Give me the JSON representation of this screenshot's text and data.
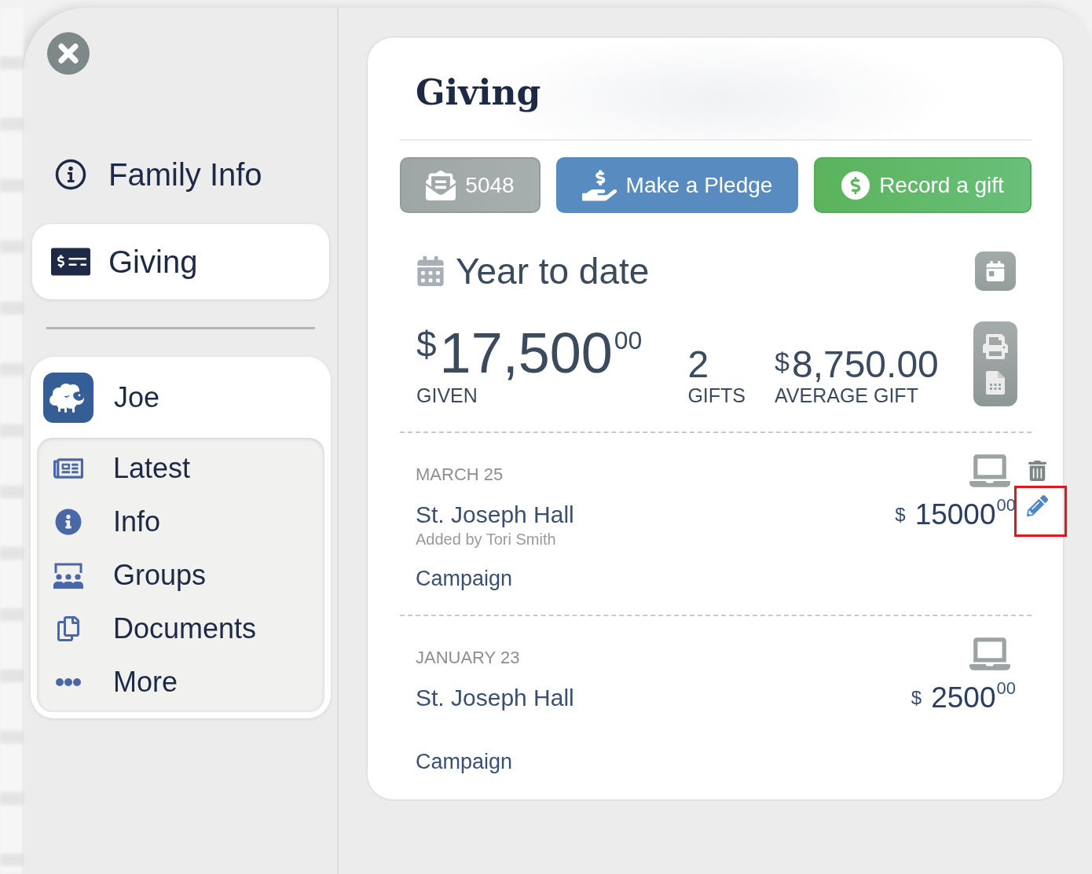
{
  "sidebar": {
    "items": [
      {
        "label": "Family Info",
        "selected": false
      },
      {
        "label": "Giving",
        "selected": true
      }
    ]
  },
  "person": {
    "name": "Joe",
    "menu": [
      {
        "label": "Latest"
      },
      {
        "label": "Info"
      },
      {
        "label": "Groups"
      },
      {
        "label": "Documents"
      },
      {
        "label": "More"
      }
    ]
  },
  "main": {
    "title": "Giving",
    "actions": [
      {
        "kind": "count",
        "label": "5048"
      },
      {
        "kind": "pledge",
        "label": "Make a Pledge"
      },
      {
        "kind": "record",
        "label": "Record a gift"
      }
    ],
    "summary": {
      "heading": "Year to date",
      "given": {
        "currency": "$",
        "amount": "17,500",
        "cents": "00",
        "label": "GIVEN"
      },
      "gifts": {
        "value": "2",
        "label": "GIFTS"
      },
      "average": {
        "currency": "$",
        "value": "8,750.00",
        "label": "AVERAGE GIFT"
      }
    },
    "gifts": [
      {
        "date": "MARCH 25",
        "fund": "St. Joseph Hall",
        "added_by": "Added by Tori Smith",
        "type": "Campaign",
        "currency": "$",
        "amount": "15000",
        "cents": "00",
        "deletable": true,
        "editable": true,
        "highlighted": true
      },
      {
        "date": "JANUARY 23",
        "fund": "St. Joseph Hall",
        "type": "Campaign",
        "currency": "$",
        "amount": "2500",
        "cents": "00",
        "deletable": false,
        "editable": false,
        "highlighted": false
      }
    ]
  }
}
